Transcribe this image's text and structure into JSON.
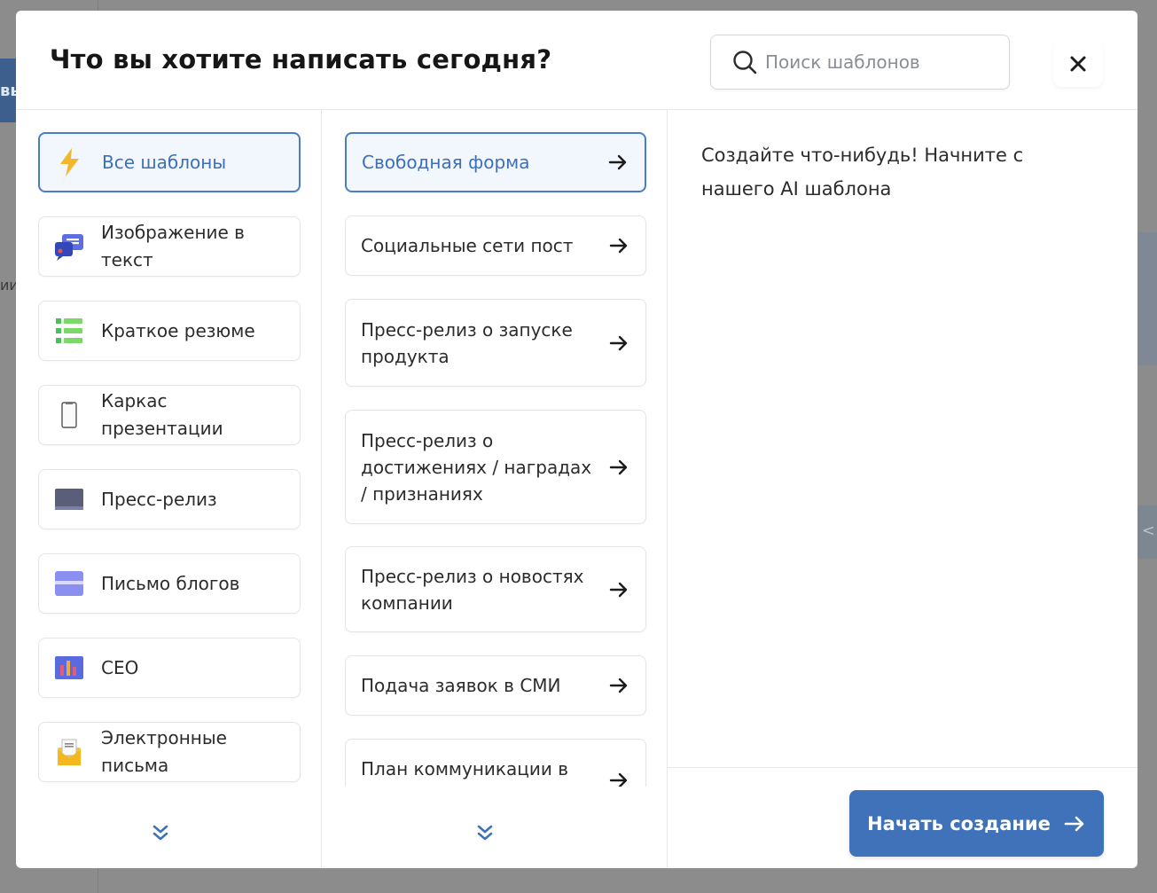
{
  "modal": {
    "title": "Что вы хотите написать сегодня?",
    "search_placeholder": "Поиск шаблонов",
    "close_label": "×"
  },
  "background": {
    "left_button_text": "вы",
    "left_text": "ии",
    "right_chevron": "<"
  },
  "categories": [
    {
      "label": "Все шаблоны",
      "icon": "lightning-icon",
      "active": true
    },
    {
      "label": "Изображение в текст",
      "icon": "image-chat-icon",
      "active": false
    },
    {
      "label": "Краткое резюме",
      "icon": "list-icon",
      "active": false
    },
    {
      "label": "Каркас презентации",
      "icon": "document-icon",
      "active": false
    },
    {
      "label": "Пресс-релиз",
      "icon": "monitor-icon",
      "active": false
    },
    {
      "label": "Письмо блогов",
      "icon": "card-icon",
      "active": false
    },
    {
      "label": "CEO",
      "icon": "chart-icon",
      "active": false
    },
    {
      "label": "Электронные письма",
      "icon": "envelope-icon",
      "active": false
    }
  ],
  "templates": [
    {
      "label": "Свободная форма",
      "active": true
    },
    {
      "label": "Социальные сети пост",
      "active": false
    },
    {
      "label": "Пресс-релиз о запуске продукта",
      "active": false
    },
    {
      "label": "Пресс-релиз о достижениях / наградах / признаниях",
      "active": false
    },
    {
      "label": "Пресс-релиз о новостях компании",
      "active": false
    },
    {
      "label": "Подача заявок в СМИ",
      "active": false
    },
    {
      "label": "План коммуникации в",
      "active": false
    }
  ],
  "preview": {
    "text": "Создайте что-нибудь! Начните с нашего AI шаблона"
  },
  "actions": {
    "start_label": "Начать создание"
  },
  "colors": {
    "accent": "#3f72b8",
    "active_border": "#4a7dc4",
    "active_bg": "#f2f7fd"
  }
}
